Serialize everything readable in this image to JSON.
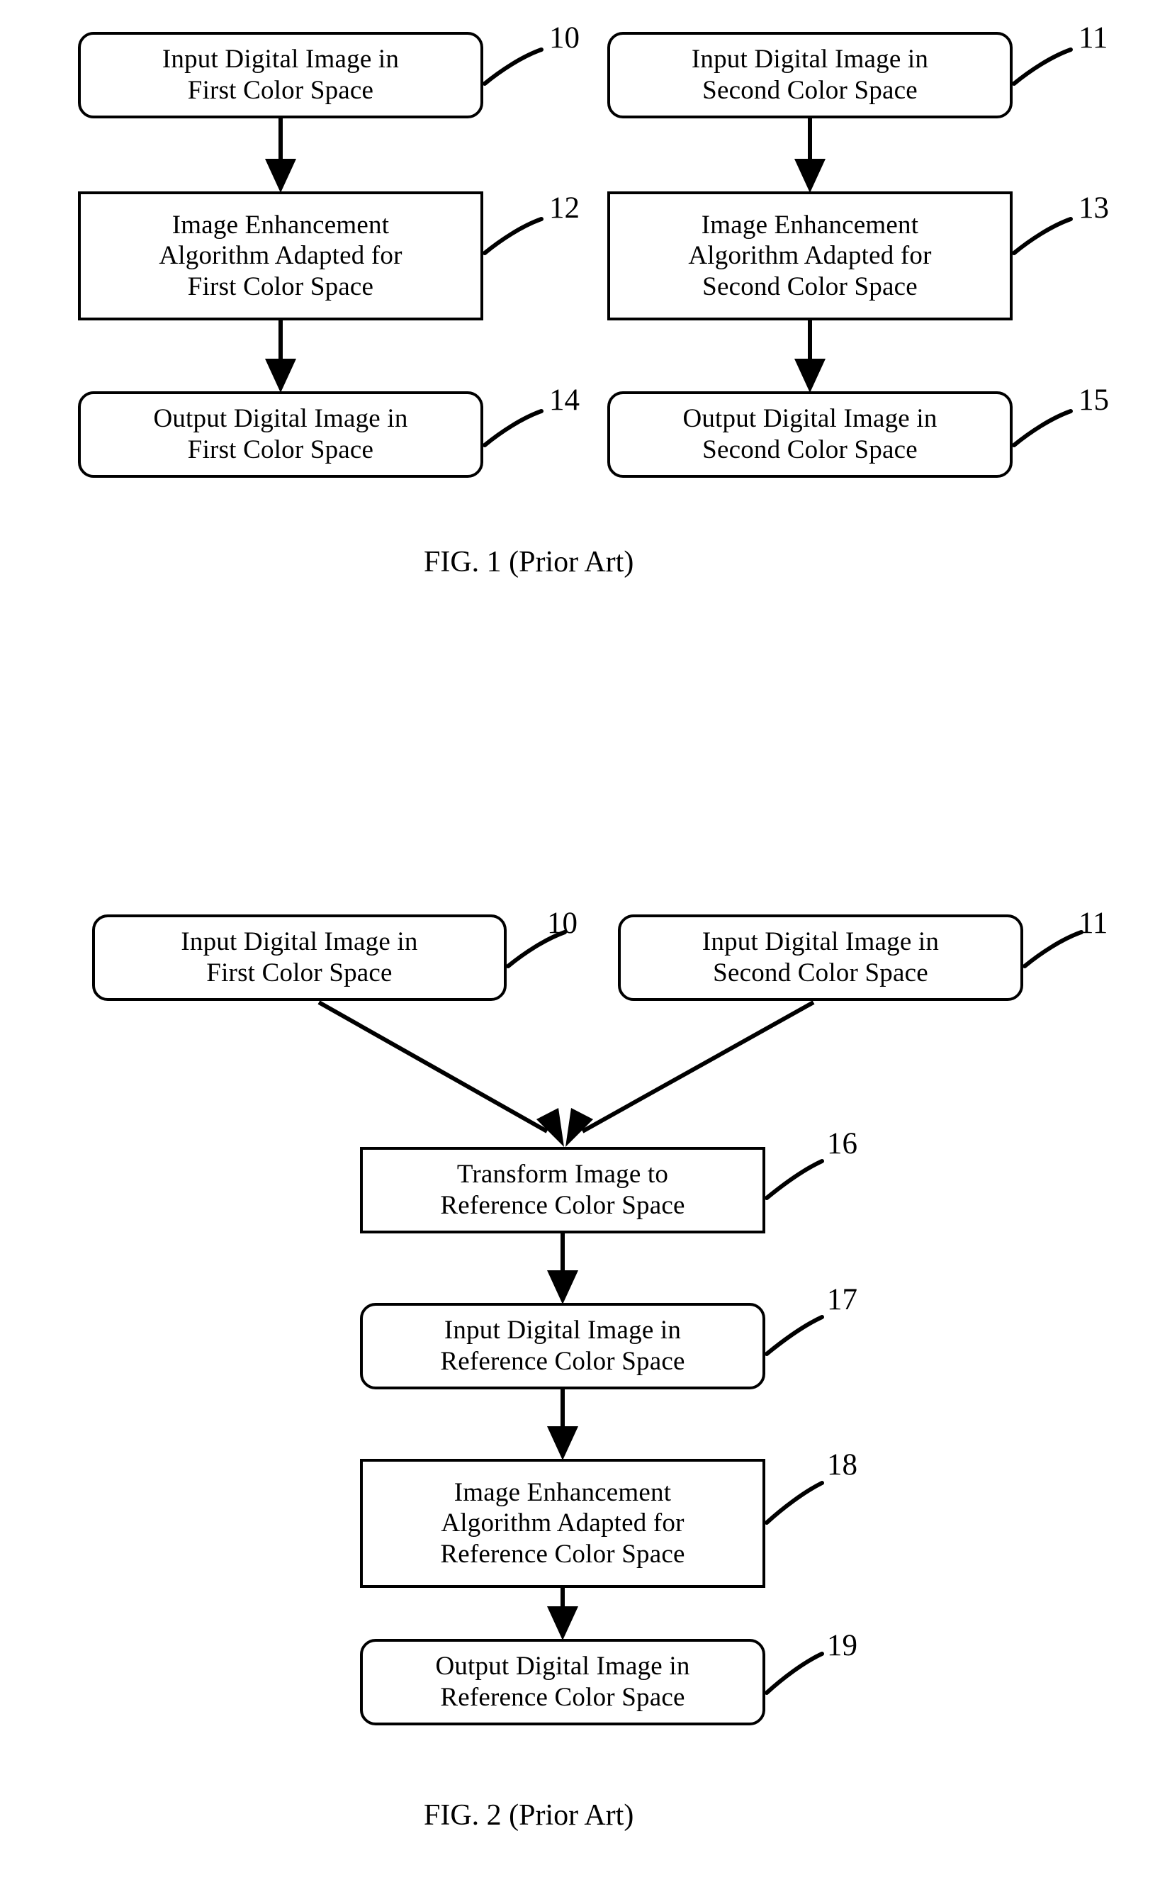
{
  "document": {
    "type": "patent-drawing-sheet",
    "background_color": "#ffffff",
    "ink_color": "#000000"
  },
  "figures": [
    {
      "id": "fig1",
      "caption": "FIG. 1  (Prior Art)",
      "nodes": [
        {
          "ref": "10",
          "shape": "rounded",
          "lines": [
            "Input Digital Image in",
            "First Color Space"
          ]
        },
        {
          "ref": "11",
          "shape": "rounded",
          "lines": [
            "Input Digital Image in",
            "Second Color Space"
          ]
        },
        {
          "ref": "12",
          "shape": "square",
          "lines": [
            "Image Enhancement",
            "Algorithm Adapted for",
            "First Color Space"
          ]
        },
        {
          "ref": "13",
          "shape": "square",
          "lines": [
            "Image Enhancement",
            "Algorithm Adapted for",
            "Second Color Space"
          ]
        },
        {
          "ref": "14",
          "shape": "rounded",
          "lines": [
            "Output Digital Image in",
            "First Color Space"
          ]
        },
        {
          "ref": "15",
          "shape": "rounded",
          "lines": [
            "Output Digital Image in",
            "Second Color Space"
          ]
        }
      ]
    },
    {
      "id": "fig2",
      "caption": "FIG. 2  (Prior Art)",
      "nodes": [
        {
          "ref": "10",
          "shape": "rounded",
          "lines": [
            "Input Digital Image in",
            "First Color Space"
          ]
        },
        {
          "ref": "11",
          "shape": "rounded",
          "lines": [
            "Input Digital Image in",
            "Second Color Space"
          ]
        },
        {
          "ref": "16",
          "shape": "square",
          "lines": [
            "Transform Image to",
            "Reference Color Space"
          ]
        },
        {
          "ref": "17",
          "shape": "rounded",
          "lines": [
            "Input Digital Image in",
            "Reference Color Space"
          ]
        },
        {
          "ref": "18",
          "shape": "square",
          "lines": [
            "Image Enhancement",
            "Algorithm Adapted for",
            "Reference Color Space"
          ]
        },
        {
          "ref": "19",
          "shape": "rounded",
          "lines": [
            "Output Digital Image in",
            "Reference Color Space"
          ]
        }
      ]
    }
  ]
}
